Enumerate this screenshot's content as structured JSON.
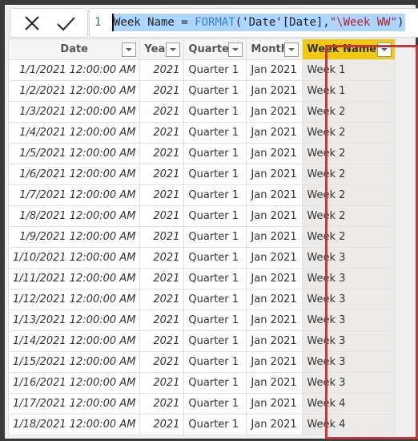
{
  "formula_bar": {
    "cancel_icon": "x-icon",
    "commit_icon": "checkmark-icon",
    "line_number": "1",
    "formula_parts": {
      "lhs": "Week Name = ",
      "func": "FORMAT",
      "args_open": "('Date'[Date],",
      "format_string": "\"\\Week WW\"",
      "args_close": ")"
    }
  },
  "table": {
    "columns": [
      {
        "label": "Date",
        "icon": "sort-ascending-icon"
      },
      {
        "label": "Year",
        "icon": "chevron-down-icon"
      },
      {
        "label": "Quarter",
        "icon": "chevron-down-icon"
      },
      {
        "label": "Month",
        "icon": "chevron-down-icon"
      },
      {
        "label": "Week Name",
        "icon": "chevron-down-icon",
        "highlight_color": "#f2c811"
      }
    ],
    "rows": [
      [
        "1/1/2021 12:00:00 AM",
        "2021",
        "Quarter 1",
        "Jan 2021",
        "Week 1"
      ],
      [
        "1/2/2021 12:00:00 AM",
        "2021",
        "Quarter 1",
        "Jan 2021",
        "Week 1"
      ],
      [
        "1/3/2021 12:00:00 AM",
        "2021",
        "Quarter 1",
        "Jan 2021",
        "Week 2"
      ],
      [
        "1/4/2021 12:00:00 AM",
        "2021",
        "Quarter 1",
        "Jan 2021",
        "Week 2"
      ],
      [
        "1/5/2021 12:00:00 AM",
        "2021",
        "Quarter 1",
        "Jan 2021",
        "Week 2"
      ],
      [
        "1/6/2021 12:00:00 AM",
        "2021",
        "Quarter 1",
        "Jan 2021",
        "Week 2"
      ],
      [
        "1/7/2021 12:00:00 AM",
        "2021",
        "Quarter 1",
        "Jan 2021",
        "Week 2"
      ],
      [
        "1/8/2021 12:00:00 AM",
        "2021",
        "Quarter 1",
        "Jan 2021",
        "Week 2"
      ],
      [
        "1/9/2021 12:00:00 AM",
        "2021",
        "Quarter 1",
        "Jan 2021",
        "Week 2"
      ],
      [
        "1/10/2021 12:00:00 AM",
        "2021",
        "Quarter 1",
        "Jan 2021",
        "Week 3"
      ],
      [
        "1/11/2021 12:00:00 AM",
        "2021",
        "Quarter 1",
        "Jan 2021",
        "Week 3"
      ],
      [
        "1/12/2021 12:00:00 AM",
        "2021",
        "Quarter 1",
        "Jan 2021",
        "Week 3"
      ],
      [
        "1/13/2021 12:00:00 AM",
        "2021",
        "Quarter 1",
        "Jan 2021",
        "Week 3"
      ],
      [
        "1/14/2021 12:00:00 AM",
        "2021",
        "Quarter 1",
        "Jan 2021",
        "Week 3"
      ],
      [
        "1/15/2021 12:00:00 AM",
        "2021",
        "Quarter 1",
        "Jan 2021",
        "Week 3"
      ],
      [
        "1/16/2021 12:00:00 AM",
        "2021",
        "Quarter 1",
        "Jan 2021",
        "Week 3"
      ],
      [
        "1/17/2021 12:00:00 AM",
        "2021",
        "Quarter 1",
        "Jan 2021",
        "Week 4"
      ],
      [
        "1/18/2021 12:00:00 AM",
        "2021",
        "Quarter 1",
        "Jan 2021",
        "Week 4"
      ]
    ]
  },
  "highlight_border_color": "#c0393b"
}
